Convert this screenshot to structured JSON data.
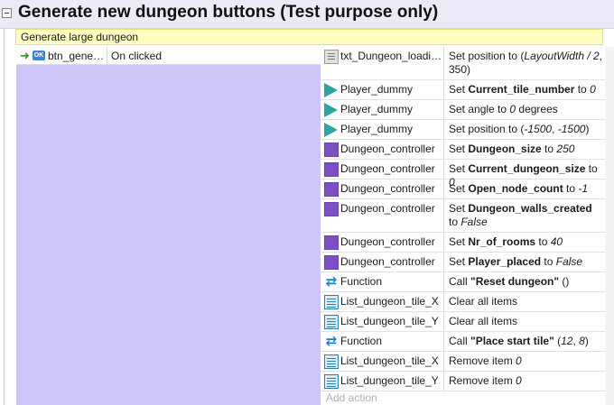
{
  "group": {
    "title": "Generate new dungeon buttons (Test purpose only)",
    "collapse_symbol": "−"
  },
  "comment": "Generate large dungeon",
  "event": {
    "trigger_icon": "green-arrow-icon",
    "object_icon": "button-icon",
    "object_icon_text": "OK",
    "object": "btn_generate_large",
    "condition": "On clicked"
  },
  "actions": [
    {
      "icon": "text-object-icon",
      "object": "txt_Dungeon_loading",
      "parts": [
        [
          "t",
          "Set position to ("
        ],
        [
          "i",
          "LayoutWidth / 2"
        ],
        [
          "t",
          ",  350)"
        ]
      ]
    },
    {
      "icon": "sprite-triangle-icon",
      "object": "Player_dummy",
      "parts": [
        [
          "t",
          "Set "
        ],
        [
          "b",
          "Current_tile_number"
        ],
        [
          "t",
          " to "
        ],
        [
          "i",
          "0"
        ]
      ]
    },
    {
      "icon": "sprite-triangle-icon",
      "object": "Player_dummy",
      "parts": [
        [
          "t",
          "Set angle to "
        ],
        [
          "i",
          "0"
        ],
        [
          "t",
          " degrees"
        ]
      ]
    },
    {
      "icon": "sprite-triangle-icon",
      "object": "Player_dummy",
      "parts": [
        [
          "t",
          "Set position to ("
        ],
        [
          "i",
          "-1500"
        ],
        [
          "t",
          ", "
        ],
        [
          "i",
          "-1500"
        ],
        [
          "t",
          ")"
        ]
      ]
    },
    {
      "icon": "purple-square-icon",
      "object": "Dungeon_controller",
      "parts": [
        [
          "t",
          "Set "
        ],
        [
          "b",
          "Dungeon_size"
        ],
        [
          "t",
          " to "
        ],
        [
          "i",
          "250"
        ]
      ]
    },
    {
      "icon": "purple-square-icon",
      "object": "Dungeon_controller",
      "parts": [
        [
          "t",
          "Set "
        ],
        [
          "b",
          "Current_dungeon_size"
        ],
        [
          "t",
          " to "
        ],
        [
          "i",
          "0"
        ]
      ]
    },
    {
      "icon": "purple-square-icon",
      "object": "Dungeon_controller",
      "parts": [
        [
          "t",
          "Set "
        ],
        [
          "b",
          "Open_node_count"
        ],
        [
          "t",
          " to "
        ],
        [
          "i",
          "-1"
        ]
      ]
    },
    {
      "icon": "purple-square-icon",
      "object": "Dungeon_controller",
      "parts": [
        [
          "t",
          "Set "
        ],
        [
          "b",
          "Dungeon_walls_created"
        ],
        [
          "t",
          " to "
        ],
        [
          "i",
          "False"
        ]
      ]
    },
    {
      "icon": "purple-square-icon",
      "object": "Dungeon_controller",
      "parts": [
        [
          "t",
          "Set "
        ],
        [
          "b",
          "Nr_of_rooms"
        ],
        [
          "t",
          " to "
        ],
        [
          "i",
          "40"
        ]
      ]
    },
    {
      "icon": "purple-square-icon",
      "object": "Dungeon_controller",
      "parts": [
        [
          "t",
          "Set "
        ],
        [
          "b",
          "Player_placed"
        ],
        [
          "t",
          " to "
        ],
        [
          "i",
          "False"
        ]
      ]
    },
    {
      "icon": "function-icon",
      "object": "Function",
      "parts": [
        [
          "t",
          "Call "
        ],
        [
          "b",
          "\"Reset dungeon\""
        ],
        [
          "t",
          " ()"
        ]
      ]
    },
    {
      "icon": "array-icon",
      "object": "List_dungeon_tile_X",
      "parts": [
        [
          "t",
          "Clear all items"
        ]
      ]
    },
    {
      "icon": "array-icon",
      "object": "List_dungeon_tile_Y",
      "parts": [
        [
          "t",
          "Clear all items"
        ]
      ]
    },
    {
      "icon": "function-icon",
      "object": "Function",
      "parts": [
        [
          "t",
          "Call "
        ],
        [
          "b",
          "\"Place start tile\""
        ],
        [
          "t",
          " ("
        ],
        [
          "i",
          "12"
        ],
        [
          "t",
          ", "
        ],
        [
          "i",
          "8"
        ],
        [
          "t",
          ")"
        ]
      ]
    },
    {
      "icon": "array-icon",
      "object": "List_dungeon_tile_X",
      "parts": [
        [
          "t",
          "Remove item "
        ],
        [
          "i",
          "0"
        ]
      ]
    },
    {
      "icon": "array-icon",
      "object": "List_dungeon_tile_Y",
      "parts": [
        [
          "t",
          "Remove item "
        ],
        [
          "i",
          "0"
        ]
      ]
    }
  ],
  "add_action_label": "Add action",
  "colors": {
    "group_bg": "#ebeaf6",
    "event_bg": "#cdc6f6",
    "comment_bg": "#ffffc4",
    "object_purple": "#7d4fc4",
    "sprite_teal": "#2aa5a0",
    "function_blue": "#1e7fc9"
  }
}
